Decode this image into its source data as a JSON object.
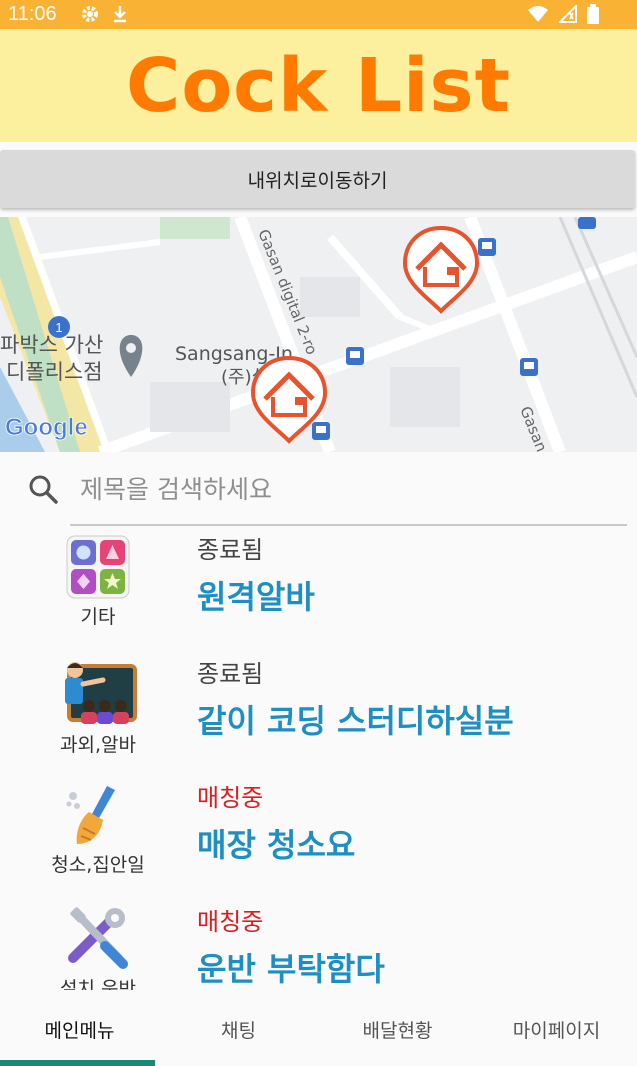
{
  "status_bar": {
    "time": "11:06",
    "icons": [
      "gear-icon",
      "download-icon",
      "wifi-icon",
      "signal-icon",
      "battery-icon"
    ]
  },
  "header": {
    "title": "Cock List",
    "background": "#fcef9e",
    "title_color": "#ff7a00"
  },
  "locate_button": {
    "label": "내위치로이동하기"
  },
  "map": {
    "labels": {
      "poi_left_line1": "파박스 가산",
      "poi_left_line2": "디폴리스점",
      "poi_center_line1": "Sangsang-In",
      "poi_center_line2": "(주)실",
      "road_vertical": "Gasan digital 2-ro",
      "road_right": "Gasan",
      "route_number": "1",
      "logo": "Google"
    },
    "markers": [
      "home-marker-icon",
      "home-marker-icon"
    ]
  },
  "search": {
    "placeholder": "제목을 검색하세요"
  },
  "posts": [
    {
      "category": "기타",
      "category_icon": "shapes-icon",
      "status": "종료됨",
      "status_color": "#444444",
      "title": "원격알바"
    },
    {
      "category": "과외,알바",
      "category_icon": "teacher-icon",
      "status": "종료됨",
      "status_color": "#444444",
      "title": "같이 코딩 스터디하실분"
    },
    {
      "category": "청소,집안일",
      "category_icon": "broom-icon",
      "status": "매칭중",
      "status_color": "#d61f1f",
      "title": "매장 청소요"
    },
    {
      "category": "설치,운반",
      "category_icon": "tools-icon",
      "status": "매칭중",
      "status_color": "#d61f1f",
      "title": "운반 부탁함다"
    }
  ],
  "bottom_nav": {
    "tabs": [
      "메인메뉴",
      "채팅",
      "배달현황",
      "마이페이지"
    ],
    "active": "메인메뉴",
    "accent": "#148a7a"
  }
}
